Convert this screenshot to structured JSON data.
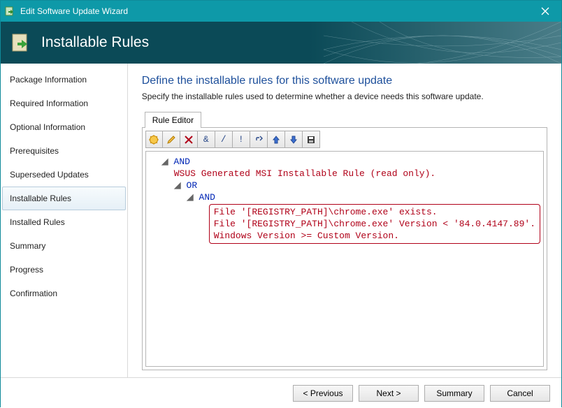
{
  "window": {
    "title": "Edit Software Update Wizard"
  },
  "banner": {
    "title": "Installable Rules"
  },
  "sidebar": {
    "items": [
      {
        "label": "Package Information",
        "active": false
      },
      {
        "label": "Required Information",
        "active": false
      },
      {
        "label": "Optional Information",
        "active": false
      },
      {
        "label": "Prerequisites",
        "active": false
      },
      {
        "label": "Superseded Updates",
        "active": false
      },
      {
        "label": "Installable Rules",
        "active": true
      },
      {
        "label": "Installed Rules",
        "active": false
      },
      {
        "label": "Summary",
        "active": false
      },
      {
        "label": "Progress",
        "active": false
      },
      {
        "label": "Confirmation",
        "active": false
      }
    ]
  },
  "content": {
    "heading": "Define the installable rules for this software update",
    "subtitle": "Specify the installable rules used to determine whether a device needs this software update.",
    "tab_label": "Rule Editor",
    "tree": {
      "root": "AND",
      "readonly_rule": "WSUS Generated MSI Installable Rule (read only).",
      "or": "OR",
      "and2": "AND",
      "sel_line1": "File '[REGISTRY_PATH]\\chrome.exe' exists.",
      "sel_line2": "File '[REGISTRY_PATH]\\chrome.exe' Version < '84.0.4147.89'.",
      "sel_line3": "Windows Version >= Custom Version."
    }
  },
  "footer": {
    "previous": "< Previous",
    "next": "Next >",
    "summary": "Summary",
    "cancel": "Cancel"
  }
}
